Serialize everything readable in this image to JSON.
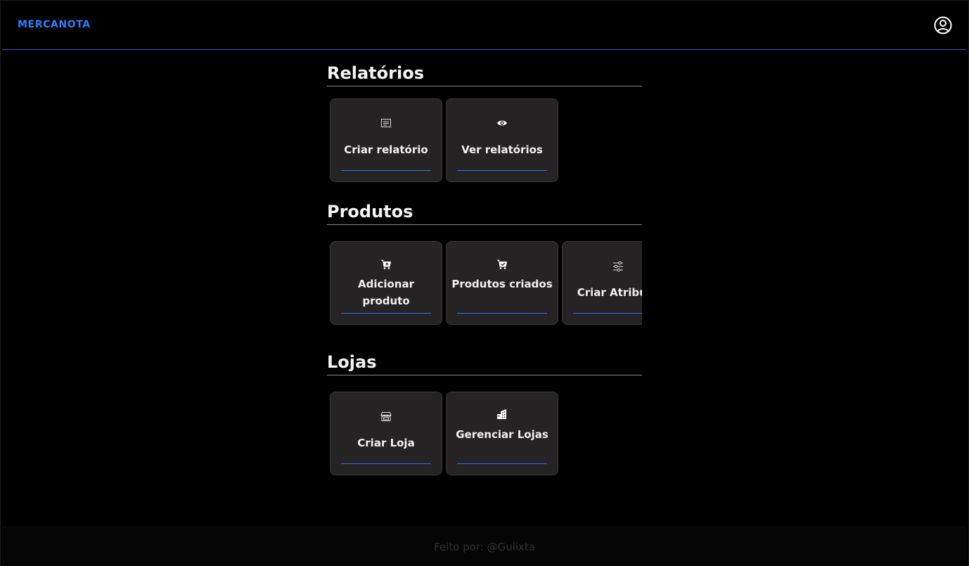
{
  "header": {
    "logo": "MERCANOTA",
    "profile_icon": "user-circle-icon"
  },
  "sections": [
    {
      "title": "Relatórios",
      "cards": [
        {
          "label": "Criar relatório",
          "icon": "document-lines-icon"
        },
        {
          "label": "Ver relatórios",
          "icon": "eye-icon"
        }
      ]
    },
    {
      "title": "Produtos",
      "cards": [
        {
          "label": "Adicionar produto",
          "icon": "cart-plus-icon"
        },
        {
          "label": "Produtos criados",
          "icon": "cart-check-icon"
        },
        {
          "label": "Criar Atributo",
          "icon": "sliders-icon"
        }
      ]
    },
    {
      "title": "Lojas",
      "cards": [
        {
          "label": "Criar Loja",
          "icon": "store-icon"
        },
        {
          "label": "Gerenciar Lojas",
          "icon": "buildings-icon"
        }
      ]
    }
  ],
  "footer": {
    "text": "Feito por: @Guiixta"
  },
  "colors": {
    "accent": "#2f7fff",
    "card_bg": "#252323",
    "underline": "#3d6fe8"
  }
}
